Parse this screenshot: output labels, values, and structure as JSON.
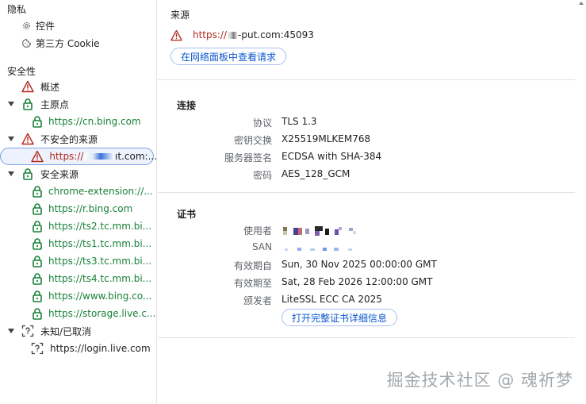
{
  "sidebar": {
    "privacy": {
      "title": "隐私",
      "items": [
        {
          "label": "控件",
          "icon": "gear-icon"
        },
        {
          "label": "第三方 Cookie",
          "icon": "cookie-icon"
        }
      ]
    },
    "security": {
      "title": "安全性",
      "overview": {
        "label": "概述",
        "icon": "warning-icon"
      },
      "main_origin": {
        "label": "主原点",
        "icon": "lock-icon",
        "children": [
          {
            "label": "https://cn.bing.com",
            "icon": "lock-icon"
          }
        ]
      },
      "insecure_origins": {
        "label": "不安全的来源",
        "icon": "warning-icon",
        "children": [
          {
            "label": "https://",
            "suffix": "ıt.com:...",
            "icon": "warning-icon"
          }
        ]
      },
      "secure_origins": {
        "label": "安全来源",
        "icon": "lock-icon",
        "children": [
          {
            "label": "chrome-extension://..."
          },
          {
            "label": "https://r.bing.com"
          },
          {
            "label": "https://ts2.tc.mm.bi..."
          },
          {
            "label": "https://ts1.tc.mm.bi..."
          },
          {
            "label": "https://ts3.tc.mm.bi..."
          },
          {
            "label": "https://ts4.tc.mm.bi..."
          },
          {
            "label": "https://www.bing.co..."
          },
          {
            "label": "https://storage.live.c..."
          }
        ]
      },
      "unknown": {
        "label": "未知/已取消",
        "icon": "unknown-icon",
        "children": [
          {
            "label": "https://login.live.com"
          }
        ]
      }
    }
  },
  "main": {
    "origin": {
      "title": "来源",
      "url_prefix": "https://",
      "url_suffix": "-put.com:45093",
      "network_button": "在网络面板中查看请求"
    },
    "connection": {
      "title": "连接",
      "rows": [
        {
          "key": "协议",
          "value": "TLS 1.3"
        },
        {
          "key": "密钥交换",
          "value": "X25519MLKEM768"
        },
        {
          "key": "服务器签名",
          "value": "ECDSA with SHA-384"
        },
        {
          "key": "密码",
          "value": "AES_128_GCM"
        }
      ]
    },
    "certificate": {
      "title": "证书",
      "subject_key": "使用者",
      "san_key": "SAN",
      "valid_from_key": "有效期自",
      "valid_from": "Sun, 30 Nov 2025 00:00:00 GMT",
      "valid_to_key": "有效期至",
      "valid_to": "Sat, 28 Feb 2026 12:00:00 GMT",
      "issuer_key": "颁发者",
      "issuer": "LiteSSL ECC CA 2025",
      "open_button": "打开完整证书详细信息"
    }
  },
  "watermark": "掘金技术社区 @ 魂祈梦",
  "colors": {
    "secure": "#188038",
    "insecure": "#b3261e",
    "link": "#0b57d0"
  }
}
